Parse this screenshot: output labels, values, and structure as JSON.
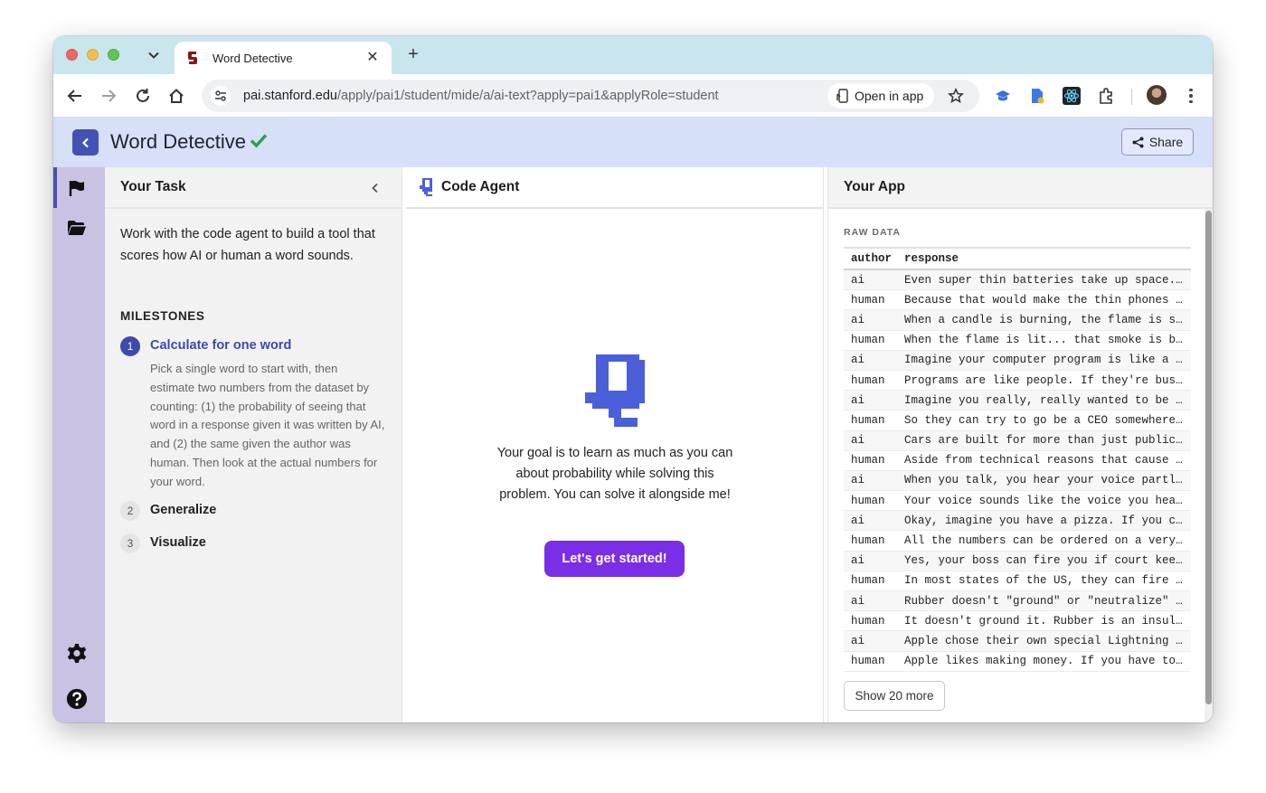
{
  "browser": {
    "tab_title": "Word Detective",
    "url_host": "pai.stanford.edu",
    "url_path": "/apply/pai1/student/mide/a/ai-text?apply=pai1&applyRole=student",
    "open_in_app_label": "Open in app",
    "new_tab_symbol": "+",
    "close_tab_symbol": "✕"
  },
  "header": {
    "title": "Word Detective",
    "share_label": "Share",
    "colors": {
      "accent": "#4451b4",
      "check": "#2e9e4f"
    }
  },
  "task_panel": {
    "title": "Your Task",
    "description": "Work with the code agent to build a tool that scores how AI or human a word sounds.",
    "milestones_heading": "MILESTONES",
    "milestones": [
      {
        "number": "1",
        "label": "Calculate for one word",
        "description": "Pick a single word to start with, then estimate two numbers from the dataset by counting: (1) the probability of seeing that word in a response given it was written by AI, and (2) the same given the author was human. Then look at the actual numbers for your word.",
        "active": true
      },
      {
        "number": "2",
        "label": "Generalize",
        "active": false
      },
      {
        "number": "3",
        "label": "Visualize",
        "active": false
      }
    ]
  },
  "agent_panel": {
    "title": "Code Agent",
    "message": "Your goal is to learn as much as you can about probability while solving this problem. You can solve it alongside me!",
    "start_button": "Let's get started!",
    "button_color": "#7a2ee6"
  },
  "app_panel": {
    "title": "Your App",
    "raw_data_heading": "RAW DATA",
    "columns": [
      "author",
      "response"
    ],
    "rows": [
      [
        "ai",
        "Even super thin batteries take up space..."
      ],
      [
        "human",
        "Because that would make the thin phones ..."
      ],
      [
        "ai",
        "When a candle is burning, the flame is s..."
      ],
      [
        "human",
        "When the flame is lit... that smoke is b..."
      ],
      [
        "ai",
        "Imagine your computer program is like a ..."
      ],
      [
        "human",
        "Programs are like people. If they're bus..."
      ],
      [
        "ai",
        "Imagine you really, really wanted to be ..."
      ],
      [
        "human",
        "So they can try to go be a CEO somewhere..."
      ],
      [
        "ai",
        "Cars are built for more than just public..."
      ],
      [
        "human",
        "Aside from technical reasons that cause ..."
      ],
      [
        "ai",
        "When you talk, you hear your voice partl..."
      ],
      [
        "human",
        "Your voice sounds like the voice you hea..."
      ],
      [
        "ai",
        "Okay, imagine you have a pizza. If you c..."
      ],
      [
        "human",
        "All the numbers can be ordered on a very..."
      ],
      [
        "ai",
        "Yes, your boss can fire you if court kee..."
      ],
      [
        "human",
        "In most states of the US, they can fire ..."
      ],
      [
        "ai",
        "Rubber doesn't \"ground\" or \"neutralize\" ..."
      ],
      [
        "human",
        "It doesn't ground it. Rubber is an insul..."
      ],
      [
        "ai",
        "Apple chose their own special Lightning ..."
      ],
      [
        "human",
        "Apple likes making money. If you have to..."
      ]
    ],
    "show_more_label": "Show 20 more"
  },
  "icons": {
    "rail": [
      "flag-icon",
      "folder-icon",
      "gear-icon",
      "help-icon"
    ],
    "toolbar": [
      "back-icon",
      "forward-icon",
      "reload-icon",
      "home-icon",
      "site-info-icon",
      "star-icon",
      "extensions-icon"
    ]
  }
}
